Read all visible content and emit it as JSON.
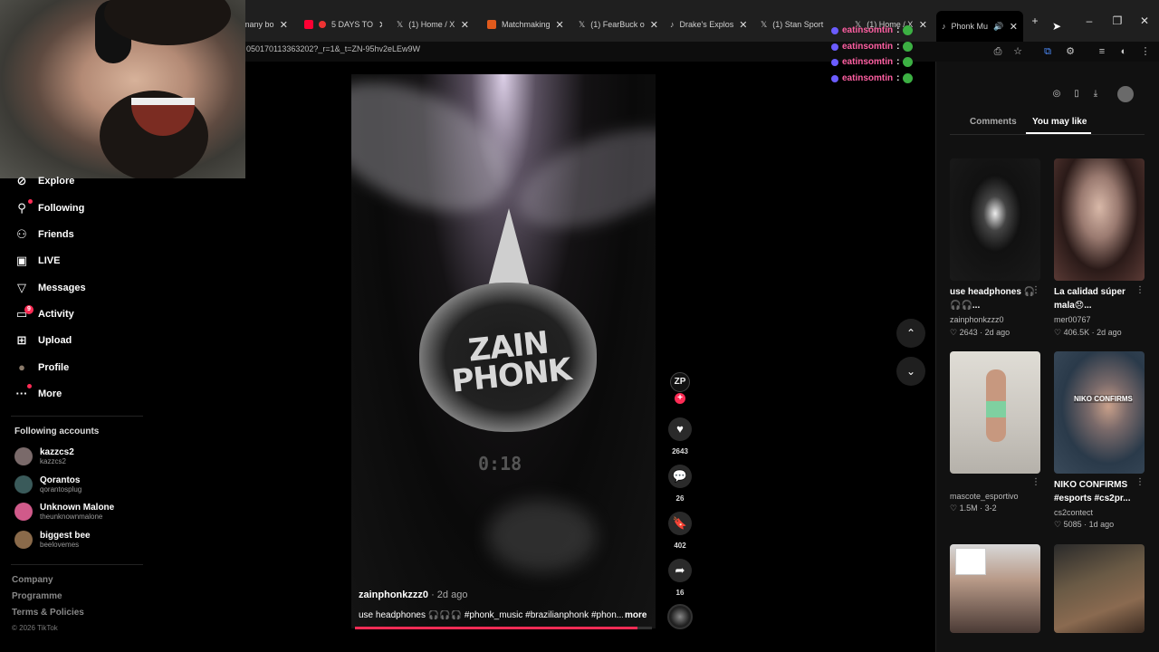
{
  "browser": {
    "tabs": [
      {
        "label": "many bo",
        "color": "#555"
      },
      {
        "label": "5 DAYS TO",
        "color": "#ff0033"
      },
      {
        "label": "(1) Home / X",
        "color": "#ffffff"
      },
      {
        "label": "Matchmaking",
        "color": "#e05a1c"
      },
      {
        "label": "(1) FearBuck o",
        "color": "#ffffff"
      },
      {
        "label": "Drake's Explos",
        "color": "#ffffff"
      },
      {
        "label": "(1) Stan Sport",
        "color": "#ffffff"
      },
      {
        "label": "(1) Home / X",
        "color": "#ffffff"
      },
      {
        "label": "Phonk Mu",
        "color": "#ffffff"
      }
    ],
    "new_tab": "+",
    "url": "050170113363202?_r=1&_t=ZN-95hv2eLEw9W"
  },
  "chat": {
    "lines": [
      {
        "user": "eatinsomtin",
        "sep": ":"
      },
      {
        "user": "eatinsomtin",
        "sep": ":"
      },
      {
        "user": "eatinsomtin",
        "sep": ":"
      },
      {
        "user": "eatinsomtin",
        "sep": ":"
      },
      {
        "user": "eatinsomtin",
        "sep": ":"
      }
    ]
  },
  "sidebar": {
    "nav": [
      {
        "label": "Explore",
        "icon": "compass-icon",
        "glyph": "⊘"
      },
      {
        "label": "Following",
        "icon": "following-icon",
        "glyph": "⚲"
      },
      {
        "label": "Friends",
        "icon": "friends-icon",
        "glyph": "⚇"
      },
      {
        "label": "LIVE",
        "icon": "live-icon",
        "glyph": "▣"
      },
      {
        "label": "Messages",
        "icon": "messages-icon",
        "glyph": "▽"
      },
      {
        "label": "Activity",
        "icon": "activity-icon",
        "glyph": "▭"
      },
      {
        "label": "Upload",
        "icon": "upload-icon",
        "glyph": "⊞"
      },
      {
        "label": "Profile",
        "icon": "profile-icon",
        "glyph": "●"
      },
      {
        "label": "More",
        "icon": "more-icon",
        "glyph": "···"
      }
    ],
    "activity_badge": "9",
    "following_title": "Following accounts",
    "accounts": [
      {
        "name": "kazzcs2",
        "handle": "kazzcs2",
        "color": "#7a6a6a"
      },
      {
        "name": "Qorantos",
        "handle": "qorantosplug",
        "color": "#3a5a5a"
      },
      {
        "name": "Unknown Malone",
        "handle": "theunknownmalone",
        "color": "#d05a8a"
      },
      {
        "name": "biggest bee",
        "handle": "beelovemes",
        "color": "#8a6a4a"
      }
    ],
    "footer": [
      "Company",
      "Programme",
      "Terms & Policies"
    ],
    "copyright": "© 2026 TikTok"
  },
  "video": {
    "overlay_text": "ZAIN PHONK",
    "overlay_num": "0:18",
    "author": "zainphonkzzz0",
    "date": " · 2d ago",
    "caption": "use headphones 🎧🎧🎧 #phonk_music #brazilianphonk #phon...",
    "more": "more",
    "progress": 0.95,
    "creator_glyph": "ZP",
    "likes": "2643",
    "comments": "26",
    "saves": "402",
    "shares": "16"
  },
  "right_panel": {
    "tabs": [
      "Comments",
      "You may like"
    ],
    "active_tab": "You may like",
    "cards": [
      {
        "title": "use headphones 🎧🎧🎧...",
        "user": "zainphonkzzz0",
        "likes": "2643",
        "age": "2d ago",
        "bg": "#1a1a1a"
      },
      {
        "title": "La calidad súper mala😞...",
        "user": "mer00767",
        "likes": "406.5K",
        "age": "2d ago",
        "bg": "#7a5a55"
      },
      {
        "title": "",
        "user": "mascote_esportivo",
        "likes": "1.5M",
        "age": "3-2",
        "bg": "#c8c4bd"
      },
      {
        "title": "NIKO CONFIRMS #esports #cs2pr...",
        "user": "cs2contect",
        "likes": "5085",
        "age": "1d ago",
        "bg": "#3a4a5a",
        "overlay": "NIKO CONFIRMS"
      },
      {
        "title": "",
        "user": "",
        "likes": "",
        "age": "",
        "bg": "#5a4a45"
      },
      {
        "title": "",
        "user": "",
        "likes": "",
        "age": "",
        "bg": "#5a4a3a"
      }
    ]
  }
}
